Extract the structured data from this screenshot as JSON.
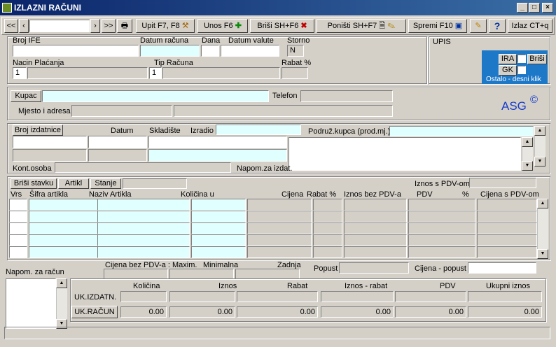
{
  "window": {
    "title": "IZLAZNI RAČUNI"
  },
  "toolbar": {
    "first": "<<",
    "prev": "‹",
    "next": "›",
    "last": ">>",
    "upit": "Upit F7, F8",
    "unos": "Unos F6",
    "brisi": "Briši  SH+F6",
    "ponisti": "Poništi SH+F7",
    "spremi": "Spremi F10",
    "izlaz": "Izlaz CT+q"
  },
  "header": {
    "broj_ife": "Broj IFE",
    "datum_racuna": "Datum računa",
    "dana": "Dana",
    "datum_valute": "Datum valute",
    "storno": "Storno",
    "storno_val": "N",
    "nacin_placanja": "Nacin Plaćanja",
    "nacin_val": "1",
    "tip_racuna": "Tip Računa",
    "tip_val": "1",
    "rabat": "Rabat %"
  },
  "upis": {
    "label": "UPIS",
    "ira": "IRA",
    "brisi": "Briši",
    "gk": "GK",
    "ostalo": "Ostalo - desni  klik"
  },
  "kupac": {
    "btn": "Kupac",
    "telefon": "Telefon",
    "mjesto": "Mjesto i adresa",
    "logo": "ASG",
    "copy": "©"
  },
  "izdatnica": {
    "broj_btn": "Broj izdatnice",
    "datum": "Datum",
    "skladiste": "Skladište",
    "izradio": "Izradio",
    "podruz": "Podruž.kupca (prod.mj.)",
    "kont": "Kont.osoba",
    "napom": "Napom.za izdat."
  },
  "stavke": {
    "brisi_btn": "Briši stavku",
    "artikl_btn": "Artikl",
    "stanje_btn": "Stanje",
    "iznos_pdv": "Iznos s PDV-om",
    "cols": [
      "Vrs",
      "Šifra artikla",
      "Naziv Artikla",
      "Količina u",
      "Cijena",
      "Rabat %",
      "Iznos bez PDV-a",
      "PDV",
      "%",
      "Cijena s PDV-om"
    ]
  },
  "footer": {
    "napom_racun": "Napom. za račun",
    "cijena_bez": "Cijena bez PDV-a : Maxim.",
    "minimalna": "Minimalna",
    "zadnja": "Zadnja",
    "popust": "Popust",
    "cijena_popust": "Cijena - popust"
  },
  "totals": {
    "cols": [
      "Količina",
      "Iznos",
      "Rabat",
      "Iznos - rabat",
      "PDV",
      "Ukupni iznos"
    ],
    "uk_izdatn": "UK.IZDATN.",
    "uk_racun": "UK.RAČUN",
    "vals": [
      "0.00",
      "0.00",
      "0.00",
      "0.00",
      "0.00",
      "0.00"
    ]
  },
  "colors": {
    "title_start": "#0a246a",
    "title_end": "#3a6ea5",
    "cyan": "#e0ffff",
    "upis_bg": "#1e78c8",
    "logo": "#1a3cc8"
  }
}
